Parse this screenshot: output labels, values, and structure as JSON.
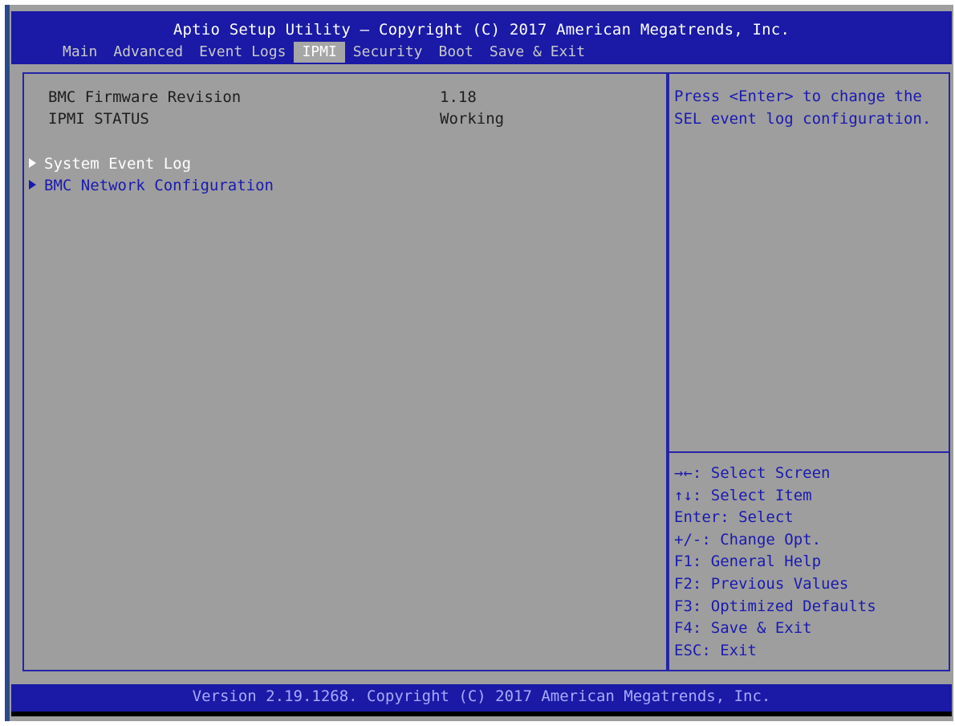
{
  "header": {
    "title": "Aptio Setup Utility – Copyright (C) 2017 American Megatrends, Inc.",
    "tabs": [
      "Main",
      "Advanced",
      "Event Logs",
      "IPMI",
      "Security",
      "Boot",
      "Save & Exit"
    ],
    "active_tab": "IPMI"
  },
  "main": {
    "info": [
      {
        "label": "BMC Firmware Revision",
        "value": "1.18"
      },
      {
        "label": "IPMI STATUS",
        "value": "Working"
      }
    ],
    "submenus": [
      {
        "label": "System Event Log",
        "selected": true
      },
      {
        "label": "BMC Network Configuration",
        "selected": false
      }
    ]
  },
  "help": {
    "description": "Press <Enter> to change the SEL event log configuration.",
    "description_lines": [
      "Press <Enter> to change the",
      "SEL event log configuration."
    ],
    "keys": [
      "→←: Select Screen",
      "↑↓: Select Item",
      "Enter: Select",
      "+/-: Change Opt.",
      "F1: General Help",
      "F2: Previous Values",
      "F3: Optimized Defaults",
      "F4: Save & Exit",
      "ESC: Exit"
    ]
  },
  "footer": {
    "text": "Version 2.19.1268. Copyright (C) 2017 American Megatrends, Inc."
  },
  "colors": {
    "header_bg": "#1a1aa6",
    "panel_bg": "#9e9e9e",
    "accent_text": "#1a1ab0",
    "border": "#2424a8"
  }
}
